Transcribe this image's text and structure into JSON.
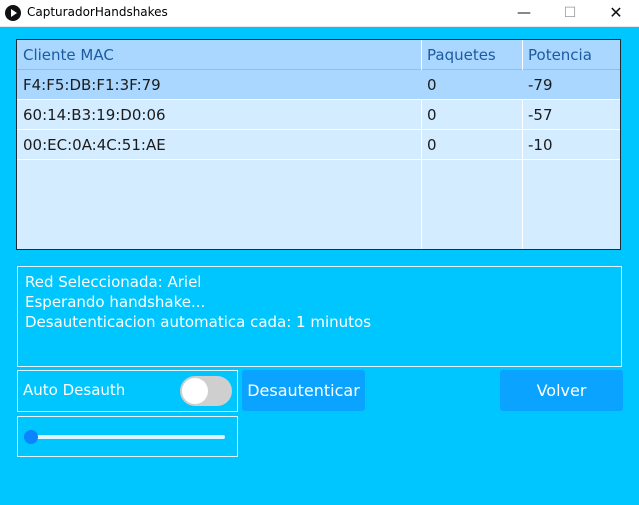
{
  "window": {
    "title": "CapturadorHandshakes",
    "controls": {
      "minimize": "—",
      "maximize": "☐",
      "close": "✕"
    }
  },
  "table": {
    "headers": [
      "Cliente MAC",
      "Paquetes",
      "Potencia"
    ],
    "rows": [
      [
        "F4:F5:DB:F1:3F:79",
        "0",
        "-79"
      ],
      [
        "60:14:B3:19:D0:06",
        "0",
        "-57"
      ],
      [
        "00:EC:0A:4C:51:AE",
        "0",
        "-10"
      ]
    ]
  },
  "info": {
    "line1": "Red Seleccionada: Ariel",
    "line2": "Esperando handshake...",
    "line3": "Desautenticacion automatica cada: 1 minutos"
  },
  "controls": {
    "auto_desauth_label": "Auto Desauth",
    "auto_desauth_on": false,
    "desauth_button": "Desautenticar",
    "back_button": "Volver",
    "slider_value": 0
  },
  "colors": {
    "background": "#00c6ff",
    "table_header": "#a9d7ff",
    "table_body": "#d4ecff",
    "button": "#0aa3ff"
  },
  "icons": {
    "app": "play-circle-icon",
    "toggle": "toggle-switch-icon"
  }
}
